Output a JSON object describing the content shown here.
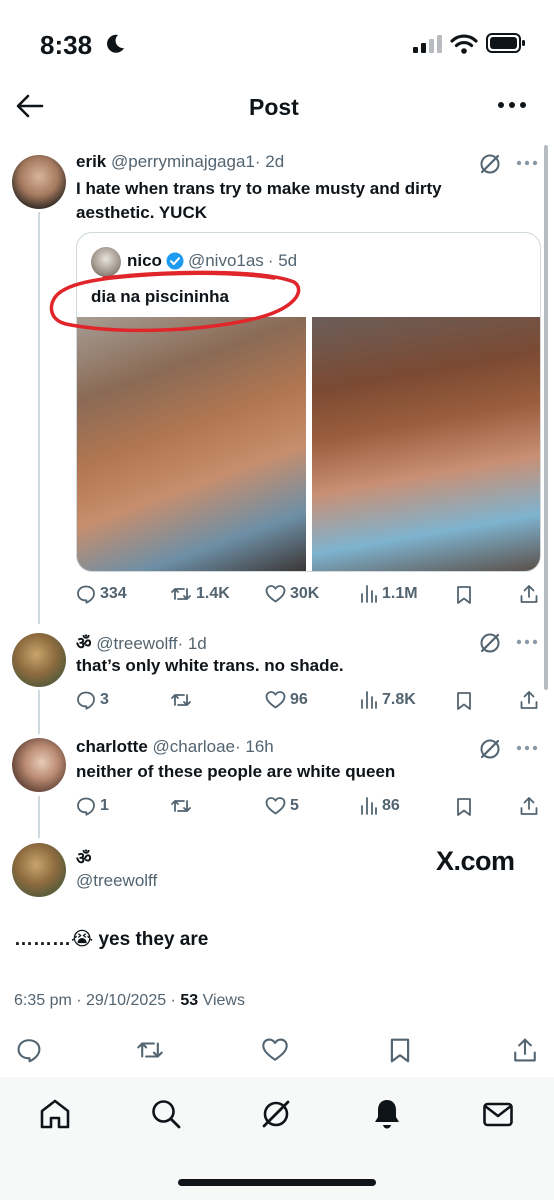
{
  "status": {
    "time": "8:38"
  },
  "header": {
    "title": "Post"
  },
  "tweets": [
    {
      "name": "erik",
      "handle": "@perryminajgaga1",
      "time": "· 2d",
      "text_line1": "I hate when trans try to make musty and dirty",
      "text_line2": "aesthetic. YUCK",
      "replies": "334",
      "reposts": "1.4K",
      "likes": "30K",
      "views": "1.1M"
    },
    {
      "name": "ॐ",
      "handle": "@treewolff",
      "time": "· 1d",
      "text": "that’s only white trans. no shade.",
      "replies": "3",
      "reposts": "",
      "likes": "96",
      "views": "7.8K"
    },
    {
      "name": "charlotte",
      "handle": "@charloae",
      "time": "· 16h",
      "text": "neither of these people are white queen",
      "replies": "1",
      "reposts": "",
      "likes": "5",
      "views": "86"
    }
  ],
  "quoted": {
    "name": "nico",
    "handle": "@nivo1as",
    "time": "· 5d",
    "text": "dia na piscininha"
  },
  "main_post": {
    "name": "ॐ",
    "handle": "@treewolff",
    "watermark": "X.com",
    "text": "………😭 yes they are",
    "timestamp": "6:35 pm · 29/10/2025 ·",
    "views_count": "53",
    "views_label": "Views"
  },
  "colors": {
    "accent": "#1d9bf0",
    "annotation": "#e0262b",
    "text_secondary": "#536471"
  }
}
